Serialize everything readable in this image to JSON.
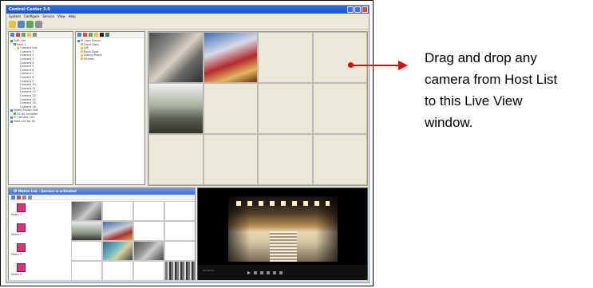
{
  "app": {
    "title": "Control Center 3.0",
    "menus": [
      "System",
      "Configure",
      "Service",
      "View",
      "Help"
    ]
  },
  "host_list": {
    "items": [
      "DVR List",
      "Host 1",
      "Camera List",
      "Camera 1",
      "Camera 2",
      "Camera 3",
      "Camera 4",
      "Camera 5",
      "Camera 6",
      "Camera 7",
      "Camera 8",
      "Camera 9",
      "Camera 10",
      "Camera 11",
      "Camera 12",
      "Camera 13",
      "Camera 14",
      "Camera 15",
      "Camera 16",
      "Video Server List",
      "VS 60 encoder",
      "IP Camera List",
      "Host List for ID"
    ]
  },
  "group_list": {
    "items": [
      "IP Cam Group",
      "Front Gate",
      "Lift",
      "Back Door",
      "Dining Room",
      "Kitchen"
    ]
  },
  "matrix": {
    "title": "IP Matrix List - Service is activated",
    "items": [
      "Matrix 1",
      "Matrix 2",
      "Matrix 3",
      "Matrix 4"
    ]
  },
  "player": {
    "info": "00:00:00"
  },
  "callout": {
    "lines": [
      "Drag and drop any",
      "camera from Host List",
      "to this Live View",
      "window."
    ],
    "arrow_color": "#e00000"
  }
}
